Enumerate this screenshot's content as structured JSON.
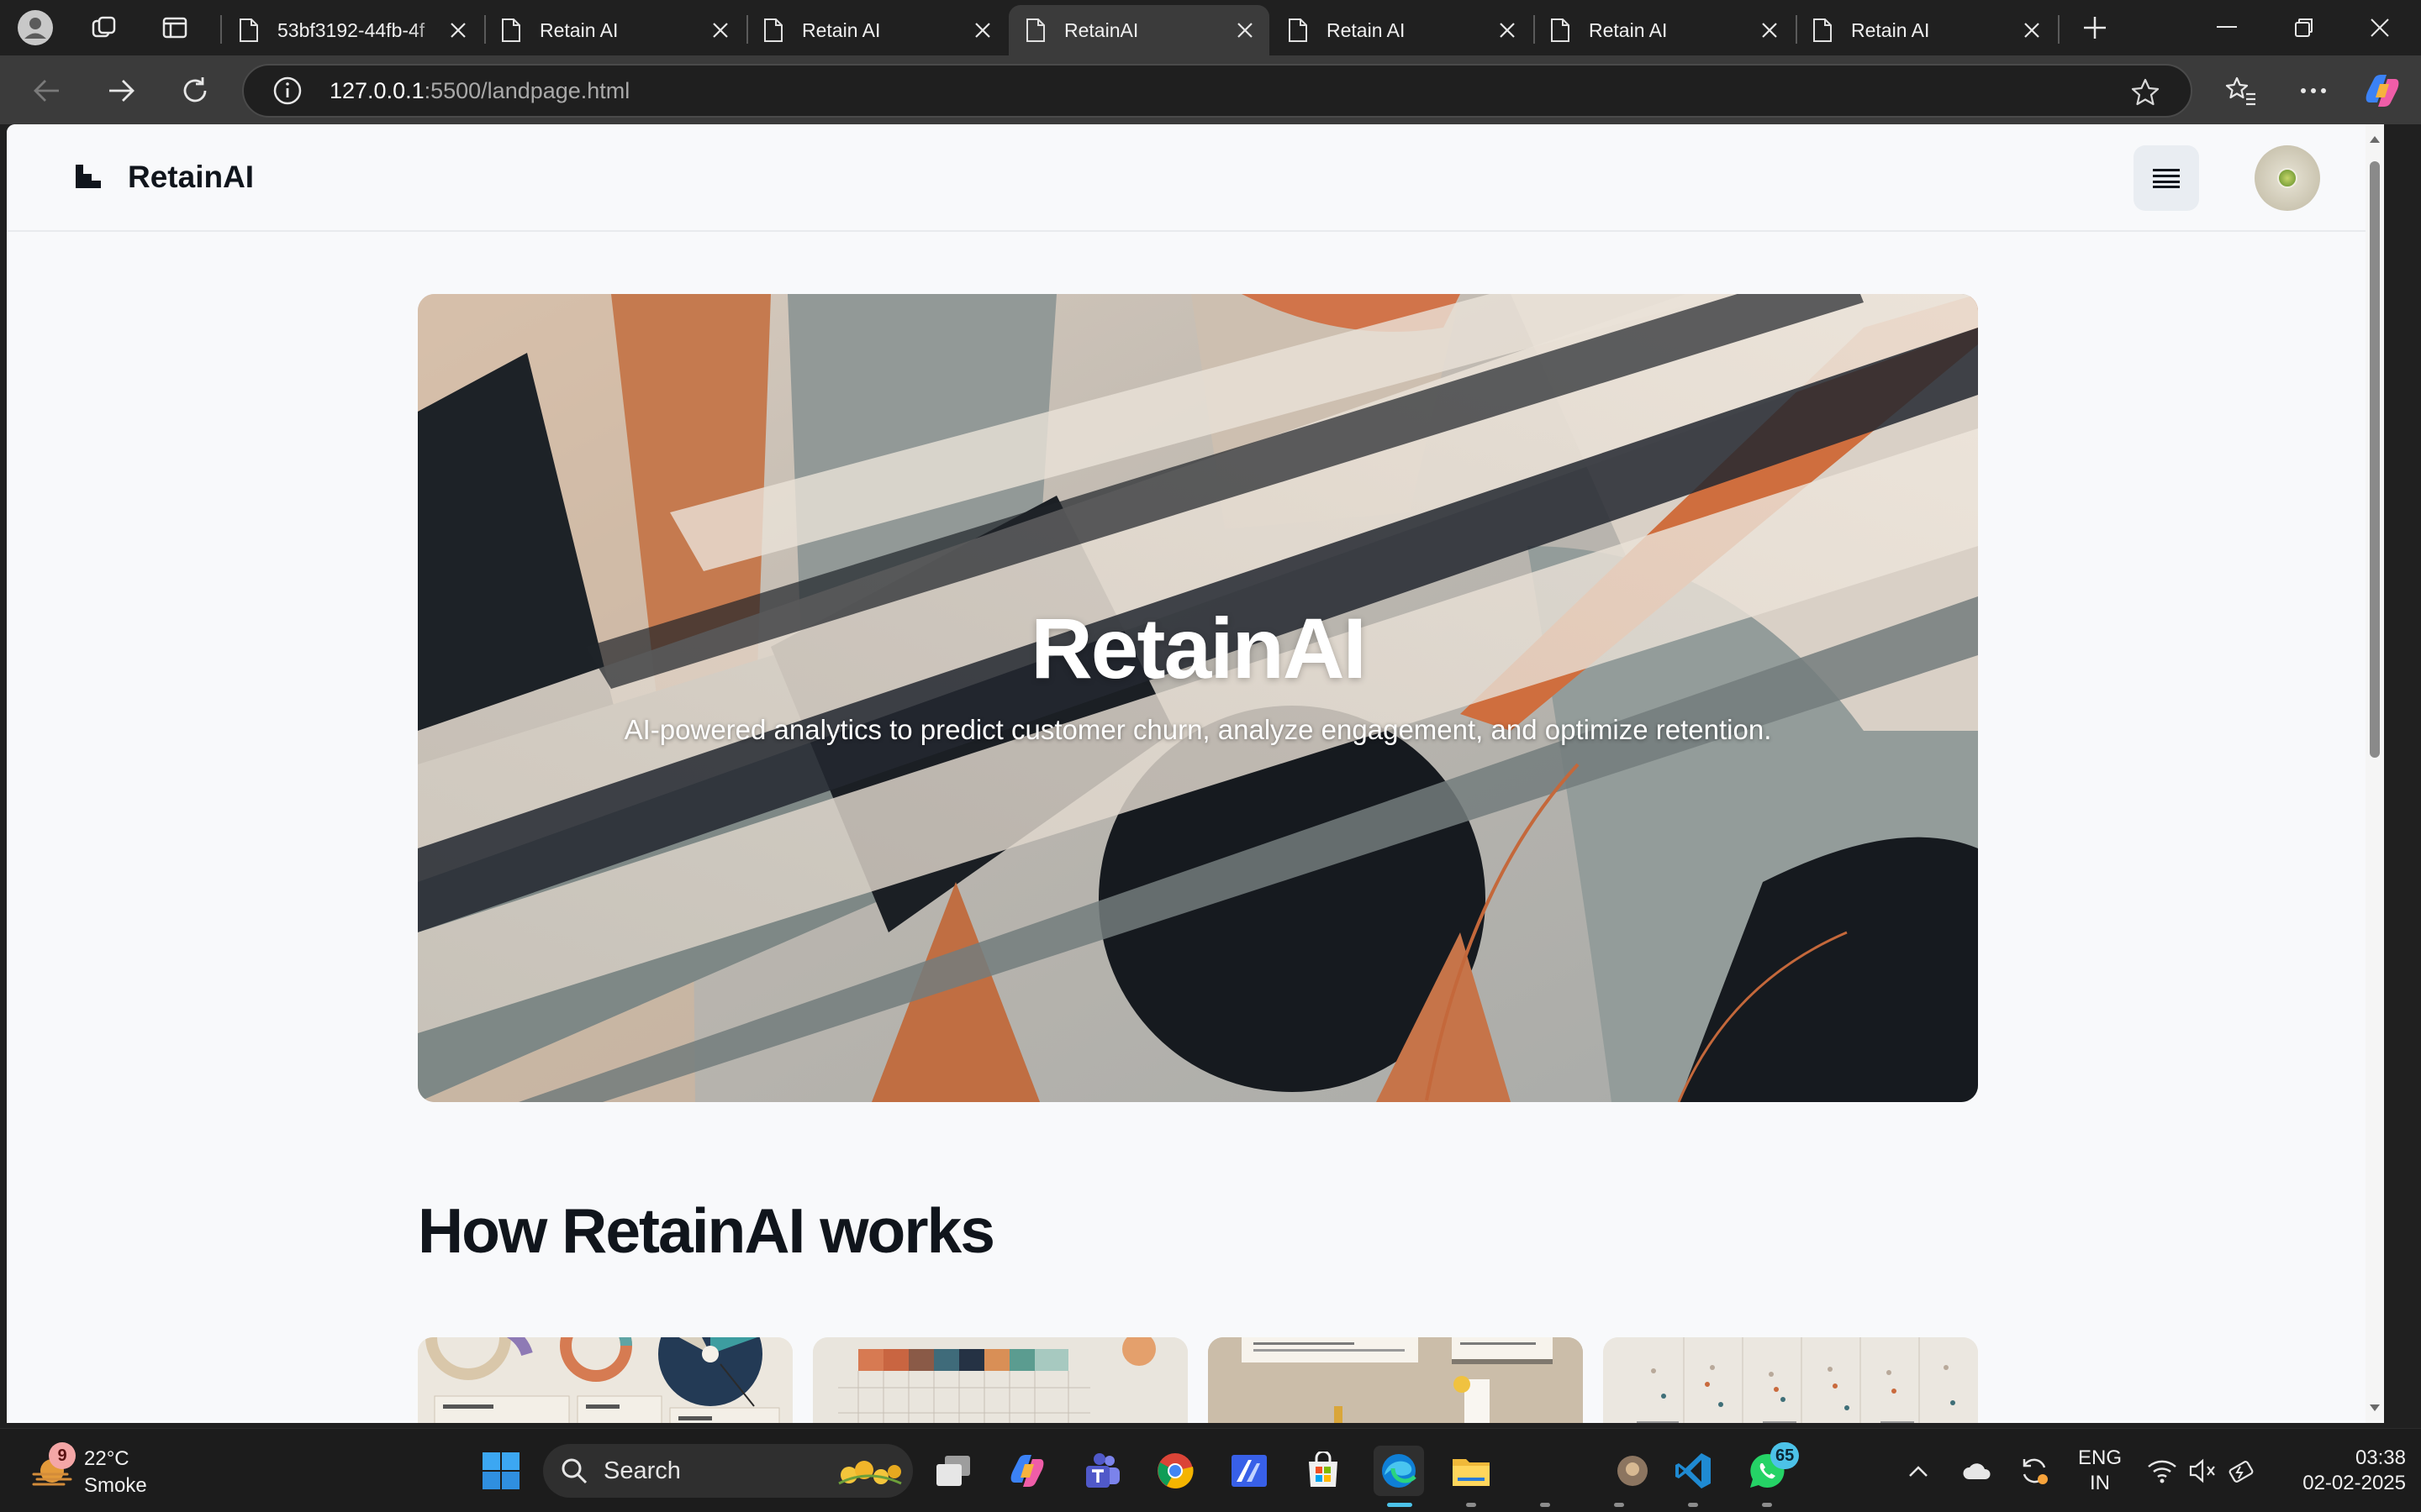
{
  "browser": {
    "tabs": [
      {
        "title": "53bf3192-44fb-4f",
        "active": false
      },
      {
        "title": "Retain AI",
        "active": false
      },
      {
        "title": "Retain AI",
        "active": false
      },
      {
        "title": "RetainAI",
        "active": true
      },
      {
        "title": "Retain AI",
        "active": false
      },
      {
        "title": "Retain AI",
        "active": false
      },
      {
        "title": "Retain AI",
        "active": false
      }
    ],
    "url_host": "127.0.0.1",
    "url_path": ":5500/landpage.html"
  },
  "site": {
    "brand": "RetainAI",
    "hero_title": "RetainAI",
    "hero_subtitle": "AI-powered analytics to predict customer churn, analyze engagement, and optimize retention.",
    "section_title": "How RetainAI works"
  },
  "taskbar": {
    "weather_temp": "22°C",
    "weather_desc": "Smoke",
    "weather_badge": "9",
    "search_label": "Search",
    "whatsapp_badge": "65",
    "lang_top": "ENG",
    "lang_bottom": "IN",
    "time": "03:38",
    "date": "02-02-2025"
  },
  "colors": {
    "accent": "#0078d4",
    "page_bg": "#f8f9fb",
    "heading": "#10151c"
  }
}
